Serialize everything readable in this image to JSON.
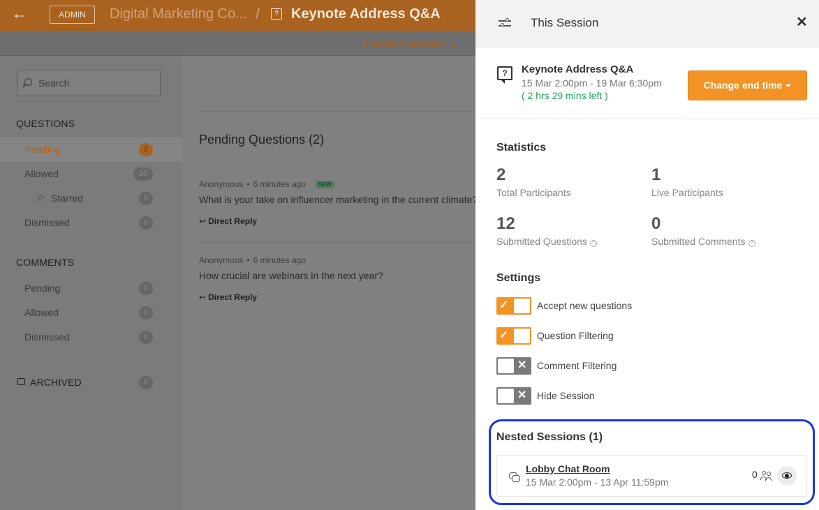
{
  "topbar": {
    "back_icon": "arrow-left-icon",
    "admin_label": "ADMIN",
    "event_title": "Digital Marketing Co...",
    "separator": "/",
    "session_title": "Keynote Address Q&A"
  },
  "subbar": {
    "nested_link": "1 nested session"
  },
  "sidebar": {
    "search_placeholder": "Search",
    "questions_heading": "QUESTIONS",
    "questions": [
      {
        "label": "Pending",
        "count": "2"
      },
      {
        "label": "Allowed",
        "count": "10"
      },
      {
        "label": "Starred",
        "count": "0"
      },
      {
        "label": "Dismissed",
        "count": "0"
      }
    ],
    "comments_heading": "COMMENTS",
    "comments": [
      {
        "label": "Pending",
        "count": "0"
      },
      {
        "label": "Allowed",
        "count": "0"
      },
      {
        "label": "Dismissed",
        "count": "0"
      }
    ],
    "archived_label": "ARCHIVED",
    "archived_count": "0"
  },
  "main": {
    "pending_title": "Pending Questions (2)",
    "questions": [
      {
        "author": "Anonymous",
        "time": "6 minutes ago",
        "badge": "NEW",
        "text": "What is your take on influencer marketing in the current climate?",
        "reply": "Direct Reply"
      },
      {
        "author": "Anonymous",
        "time": "6 minutes ago",
        "text": "How crucial are webinars in the next year?",
        "reply": "Direct Reply"
      }
    ]
  },
  "panel": {
    "title": "This Session",
    "session": {
      "name": "Keynote Address Q&A",
      "dates": "15 Mar 2:00pm - 19 Mar 6:30pm",
      "time_left": "( 2 hrs 29 mins left )",
      "change_button": "Change end time"
    },
    "statistics": {
      "title": "Statistics",
      "items": [
        {
          "value": "2",
          "label": "Total Participants"
        },
        {
          "value": "1",
          "label": "Live Participants"
        },
        {
          "value": "12",
          "label": "Submitted Questions"
        },
        {
          "value": "0",
          "label": "Submitted Comments"
        }
      ]
    },
    "settings": {
      "title": "Settings",
      "toggles": [
        {
          "label": "Accept new questions",
          "on": true
        },
        {
          "label": "Question Filtering",
          "on": true
        },
        {
          "label": "Comment Filtering",
          "on": false
        },
        {
          "label": "Hide Session",
          "on": false
        }
      ]
    },
    "nested": {
      "title": "Nested Sessions (1)",
      "room_name": "Lobby Chat Room",
      "room_dates": "15 Mar 2:00pm - 13 Apr 11:59pm",
      "participants": "0"
    }
  },
  "colors": {
    "accent": "#f39325",
    "success": "#23a35a",
    "highlight": "#1537e0"
  }
}
